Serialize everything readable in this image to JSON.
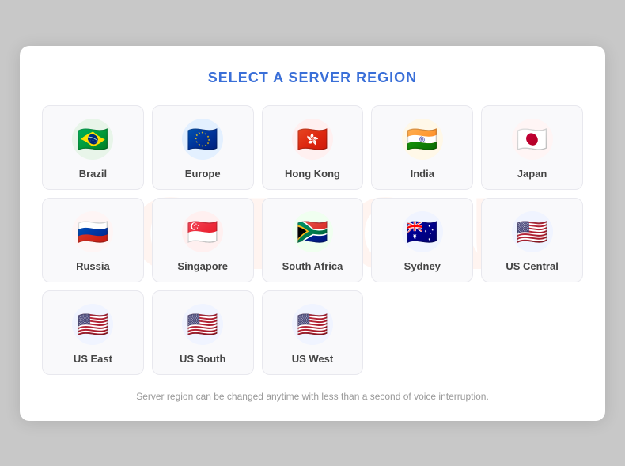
{
  "title": "SELECT A SERVER REGION",
  "regions_row1": [
    {
      "id": "brazil",
      "label": "Brazil",
      "emoji": "🇧🇷",
      "bg": "#e8f5e9"
    },
    {
      "id": "europe",
      "label": "Europe",
      "emoji": "🇪🇺",
      "bg": "#e3f0ff"
    },
    {
      "id": "hong-kong",
      "label": "Hong Kong",
      "emoji": "🇭🇰",
      "bg": "#fff0f0"
    },
    {
      "id": "india",
      "label": "India",
      "emoji": "🇮🇳",
      "bg": "#fff8e8"
    },
    {
      "id": "japan",
      "label": "Japan",
      "emoji": "🇯🇵",
      "bg": "#fff5f5"
    }
  ],
  "regions_row2": [
    {
      "id": "russia",
      "label": "Russia",
      "emoji": "🇷🇺",
      "bg": "#fef5f5"
    },
    {
      "id": "singapore",
      "label": "Singapore",
      "emoji": "🇸🇬",
      "bg": "#fff0f0"
    },
    {
      "id": "south-africa",
      "label": "South Africa",
      "emoji": "🇿🇦",
      "bg": "#f0fff0"
    },
    {
      "id": "sydney",
      "label": "Sydney",
      "emoji": "🇦🇺",
      "bg": "#f0f4ff"
    },
    {
      "id": "us-central",
      "label": "US Central",
      "emoji": "🇺🇸",
      "bg": "#f0f4ff"
    }
  ],
  "regions_row3": [
    {
      "id": "us-east",
      "label": "US East",
      "emoji": "🇺🇸",
      "bg": "#f0f4ff"
    },
    {
      "id": "us-south",
      "label": "US South",
      "emoji": "🇺🇸",
      "bg": "#f0f4ff"
    },
    {
      "id": "us-west",
      "label": "US West",
      "emoji": "🇺🇸",
      "bg": "#f0f4ff"
    }
  ],
  "footer": "Server region can be changed anytime with less than a second of voice interruption.",
  "watermark": "CITTON"
}
